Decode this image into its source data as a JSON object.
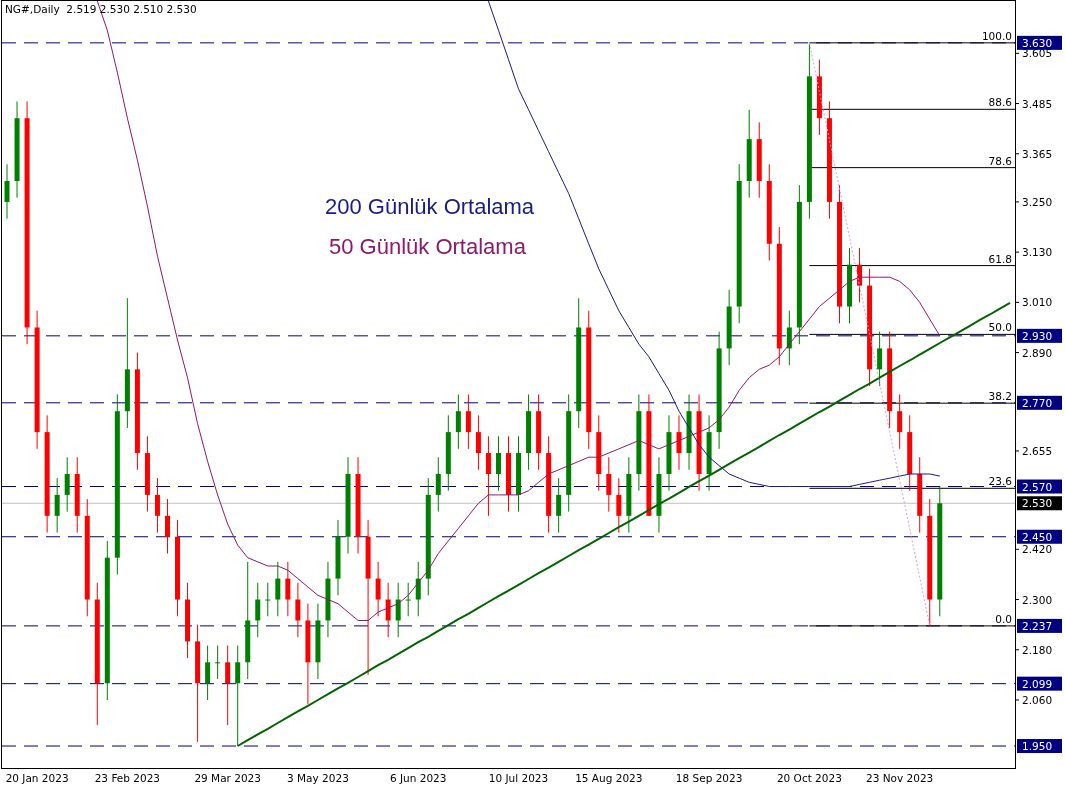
{
  "header": {
    "symbol_info": "NG#,Daily  2.519 2.530 2.510 2.530"
  },
  "chart": {
    "chart_data": {
      "type": "candlestick",
      "categories": [
        null,
        null,
        null,
        "20 Jan 2023",
        null,
        null,
        null,
        null,
        null,
        null,
        null,
        null,
        "23 Feb 2023",
        null,
        null,
        null,
        null,
        null,
        null,
        null,
        null,
        null,
        "29 Mar 2023",
        null,
        null,
        null,
        null,
        null,
        null,
        null,
        null,
        "3 May 2023",
        null,
        null,
        null,
        null,
        null,
        null,
        null,
        null,
        null,
        "6 Jun 2023",
        null,
        null,
        null,
        null,
        null,
        null,
        null,
        null,
        null,
        "10 Jul 2023",
        null,
        null,
        null,
        null,
        null,
        null,
        null,
        null,
        "15 Aug 2023",
        null,
        null,
        null,
        null,
        null,
        null,
        null,
        null,
        null,
        "18 Sep 2023",
        null,
        null,
        null,
        null,
        null,
        null,
        null,
        null,
        null,
        "20 Oct 2023",
        null,
        null,
        null,
        null,
        null,
        null,
        null,
        null,
        "23 Nov 2023",
        null,
        null,
        null,
        null,
        null,
        null,
        null,
        null,
        null,
        null,
        null
      ],
      "ylim": [
        1.8975,
        3.73
      ],
      "yticks": [
        {
          "value": 3.605,
          "label": "3.605"
        },
        {
          "value": 3.485,
          "label": "3.485"
        },
        {
          "value": 3.365,
          "label": "3.365"
        },
        {
          "value": 3.25,
          "label": "3.250"
        },
        {
          "value": 3.13,
          "label": "3.130"
        },
        {
          "value": 3.01,
          "label": "3.010"
        },
        {
          "value": 2.89,
          "label": "2.890"
        },
        {
          "value": 2.655,
          "label": "2.655"
        },
        {
          "value": 2.42,
          "label": "2.420"
        },
        {
          "value": 2.3,
          "label": "2.300"
        },
        {
          "value": 2.18,
          "label": "2.180"
        },
        {
          "value": 2.06,
          "label": "2.060"
        }
      ],
      "ohlc": [
        [
          3.25,
          3.34,
          3.21,
          3.3
        ],
        [
          3.3,
          3.49,
          3.26,
          3.45
        ],
        [
          3.45,
          3.49,
          2.91,
          2.95
        ],
        [
          2.95,
          2.99,
          2.66,
          2.7
        ],
        [
          2.7,
          2.74,
          2.46,
          2.5
        ],
        [
          2.5,
          2.59,
          2.46,
          2.55
        ],
        [
          2.55,
          2.64,
          2.51,
          2.6
        ],
        [
          2.6,
          2.64,
          2.46,
          2.5
        ],
        [
          2.5,
          2.54,
          2.26,
          2.3
        ],
        [
          2.3,
          2.34,
          2.0,
          2.1
        ],
        [
          2.1,
          2.44,
          2.06,
          2.4
        ],
        [
          2.4,
          2.79,
          2.36,
          2.75
        ],
        [
          2.75,
          3.02,
          2.71,
          2.85
        ],
        [
          2.85,
          2.89,
          2.61,
          2.65
        ],
        [
          2.65,
          2.69,
          2.51,
          2.55
        ],
        [
          2.55,
          2.59,
          2.46,
          2.5
        ],
        [
          2.5,
          2.54,
          2.41,
          2.45
        ],
        [
          2.45,
          2.49,
          2.26,
          2.3
        ],
        [
          2.3,
          2.34,
          2.16,
          2.2
        ],
        [
          2.2,
          2.24,
          1.96,
          2.1
        ],
        [
          2.1,
          2.19,
          2.06,
          2.15
        ],
        [
          2.15,
          2.19,
          2.11,
          2.15
        ],
        [
          2.15,
          2.19,
          2.0,
          2.1
        ],
        [
          2.1,
          2.19,
          1.95,
          2.15
        ],
        [
          2.15,
          2.39,
          2.11,
          2.25
        ],
        [
          2.25,
          2.34,
          2.21,
          2.3
        ],
        [
          2.3,
          2.34,
          2.26,
          2.3
        ],
        [
          2.3,
          2.39,
          2.26,
          2.35
        ],
        [
          2.35,
          2.39,
          2.26,
          2.3
        ],
        [
          2.3,
          2.34,
          2.21,
          2.25
        ],
        [
          2.25,
          2.29,
          2.05,
          2.15
        ],
        [
          2.15,
          2.29,
          2.11,
          2.25
        ],
        [
          2.25,
          2.39,
          2.21,
          2.35
        ],
        [
          2.35,
          2.49,
          2.31,
          2.45
        ],
        [
          2.45,
          2.64,
          2.41,
          2.6
        ],
        [
          2.6,
          2.64,
          2.41,
          2.45
        ],
        [
          2.45,
          2.49,
          2.12,
          2.35
        ],
        [
          2.35,
          2.39,
          2.26,
          2.3
        ],
        [
          2.3,
          2.34,
          2.21,
          2.25
        ],
        [
          2.25,
          2.34,
          2.21,
          2.3
        ],
        [
          2.3,
          2.34,
          2.26,
          2.3
        ],
        [
          2.3,
          2.39,
          2.26,
          2.35
        ],
        [
          2.35,
          2.59,
          2.31,
          2.55
        ],
        [
          2.55,
          2.64,
          2.51,
          2.6
        ],
        [
          2.6,
          2.74,
          2.56,
          2.7
        ],
        [
          2.7,
          2.79,
          2.66,
          2.75
        ],
        [
          2.75,
          2.79,
          2.66,
          2.7
        ],
        [
          2.7,
          2.74,
          2.61,
          2.65
        ],
        [
          2.65,
          2.69,
          2.5,
          2.6
        ],
        [
          2.6,
          2.69,
          2.56,
          2.65
        ],
        [
          2.65,
          2.69,
          2.51,
          2.55
        ],
        [
          2.55,
          2.69,
          2.51,
          2.65
        ],
        [
          2.65,
          2.79,
          2.61,
          2.75
        ],
        [
          2.75,
          2.79,
          2.61,
          2.65
        ],
        [
          2.65,
          2.69,
          2.46,
          2.5
        ],
        [
          2.5,
          2.59,
          2.46,
          2.55
        ],
        [
          2.55,
          2.79,
          2.51,
          2.75
        ],
        [
          2.75,
          3.02,
          2.71,
          2.95
        ],
        [
          2.95,
          2.99,
          2.66,
          2.7
        ],
        [
          2.7,
          2.74,
          2.56,
          2.6
        ],
        [
          2.6,
          2.64,
          2.51,
          2.55
        ],
        [
          2.55,
          2.59,
          2.46,
          2.5
        ],
        [
          2.5,
          2.64,
          2.46,
          2.6
        ],
        [
          2.6,
          2.79,
          2.56,
          2.75
        ],
        [
          2.75,
          2.79,
          2.5,
          2.5
        ],
        [
          2.5,
          2.64,
          2.46,
          2.6
        ],
        [
          2.6,
          2.74,
          2.56,
          2.7
        ],
        [
          2.7,
          2.74,
          2.61,
          2.65
        ],
        [
          2.65,
          2.79,
          2.61,
          2.75
        ],
        [
          2.75,
          2.79,
          2.56,
          2.6
        ],
        [
          2.6,
          2.74,
          2.56,
          2.7
        ],
        [
          2.7,
          2.94,
          2.66,
          2.9
        ],
        [
          2.9,
          3.04,
          2.86,
          3.0
        ],
        [
          3.0,
          3.34,
          2.96,
          3.3
        ],
        [
          3.3,
          3.47,
          3.26,
          3.4
        ],
        [
          3.4,
          3.44,
          3.26,
          3.3
        ],
        [
          3.3,
          3.34,
          3.11,
          3.15
        ],
        [
          3.15,
          3.19,
          2.86,
          2.9
        ],
        [
          2.9,
          2.99,
          2.86,
          2.95
        ],
        [
          2.95,
          3.29,
          2.91,
          3.25
        ],
        [
          3.25,
          3.63,
          3.21,
          3.55
        ],
        [
          3.55,
          3.59,
          3.41,
          3.45
        ],
        [
          3.45,
          3.49,
          3.21,
          3.25
        ],
        [
          3.25,
          3.29,
          2.96,
          3.0
        ],
        [
          3.0,
          3.14,
          2.96,
          3.1
        ],
        [
          3.1,
          3.14,
          3.01,
          3.05
        ],
        [
          3.05,
          3.09,
          2.81,
          2.85
        ],
        [
          2.85,
          2.94,
          2.81,
          2.9
        ],
        [
          2.9,
          2.94,
          2.71,
          2.75
        ],
        [
          2.75,
          2.79,
          2.66,
          2.7
        ],
        [
          2.7,
          2.74,
          2.56,
          2.6
        ],
        [
          2.6,
          2.64,
          2.46,
          2.5
        ],
        [
          2.5,
          2.54,
          2.237,
          2.3
        ],
        [
          2.3,
          2.57,
          2.26,
          2.53
        ],
        null,
        null,
        null,
        null,
        null,
        null,
        null
      ],
      "series": [
        {
          "name": "200 Günlük Ortalama",
          "type": "line",
          "color": "#1a1a8c",
          "values": [
            null,
            null,
            null,
            null,
            null,
            null,
            null,
            null,
            null,
            null,
            null,
            null,
            null,
            null,
            null,
            null,
            null,
            null,
            null,
            null,
            null,
            null,
            null,
            null,
            null,
            null,
            null,
            null,
            null,
            null,
            null,
            null,
            null,
            null,
            null,
            null,
            null,
            null,
            null,
            null,
            null,
            null,
            null,
            null,
            null,
            null,
            null,
            null,
            3.73,
            3.66,
            3.59,
            3.52,
            3.47,
            3.42,
            3.37,
            3.32,
            3.27,
            3.21,
            3.15,
            3.09,
            3.04,
            2.99,
            2.95,
            2.91,
            2.88,
            2.84,
            2.8,
            2.75,
            2.71,
            2.67,
            2.64,
            2.62,
            2.6,
            2.59,
            2.58,
            2.575,
            2.57,
            2.57,
            2.57,
            2.57,
            2.57,
            2.57,
            2.57,
            2.57,
            2.57,
            2.575,
            2.58,
            2.585,
            2.59,
            2.595,
            2.6,
            2.6,
            2.6,
            2.595,
            null,
            null,
            null,
            null,
            null,
            null,
            null
          ]
        },
        {
          "name": "50 Günlük Ortalama",
          "type": "line",
          "color": "#8b1a6a",
          "values": [
            null,
            null,
            null,
            null,
            null,
            null,
            null,
            null,
            null,
            3.73,
            3.66,
            3.56,
            3.45,
            3.35,
            3.24,
            3.12,
            3.02,
            2.92,
            2.83,
            2.72,
            2.63,
            2.55,
            2.48,
            2.43,
            2.4,
            2.39,
            2.38,
            2.38,
            2.37,
            2.35,
            2.33,
            2.31,
            2.3,
            2.29,
            2.27,
            2.25,
            2.25,
            2.27,
            2.28,
            2.29,
            2.31,
            2.34,
            2.37,
            2.41,
            2.44,
            2.47,
            2.5,
            2.53,
            2.55,
            2.55,
            2.55,
            2.55,
            2.56,
            2.58,
            2.6,
            2.61,
            2.62,
            2.63,
            2.64,
            2.64,
            2.65,
            2.66,
            2.67,
            2.68,
            2.67,
            2.66,
            2.67,
            2.68,
            2.69,
            2.7,
            2.71,
            2.73,
            2.76,
            2.8,
            2.83,
            2.85,
            2.86,
            2.88,
            2.91,
            2.94,
            2.97,
            3.0,
            3.02,
            3.04,
            3.06,
            3.07,
            3.07,
            3.07,
            3.07,
            3.06,
            3.04,
            3.01,
            2.97,
            2.93,
            null,
            null,
            null,
            null,
            null,
            null,
            null
          ]
        },
        {
          "type": "line",
          "color": "#006400",
          "values": [
            null,
            null,
            null,
            null,
            null,
            null,
            null,
            null,
            null,
            null,
            null,
            null,
            null,
            null,
            null,
            null,
            null,
            null,
            null,
            null,
            null,
            null,
            null,
            1.95,
            1.964,
            1.978,
            1.991,
            2.005,
            2.019,
            2.033,
            2.046,
            2.06,
            2.074,
            2.088,
            2.101,
            2.115,
            2.129,
            2.143,
            2.156,
            2.17,
            2.184,
            2.198,
            2.211,
            2.225,
            2.239,
            2.253,
            2.266,
            2.28,
            2.294,
            2.308,
            2.321,
            2.335,
            2.349,
            2.363,
            2.376,
            2.39,
            2.404,
            2.418,
            2.431,
            2.445,
            2.459,
            2.473,
            2.486,
            2.5,
            2.514,
            2.528,
            2.541,
            2.555,
            2.569,
            2.583,
            2.596,
            2.61,
            2.624,
            2.638,
            2.651,
            2.665,
            2.679,
            2.693,
            2.706,
            2.72,
            2.734,
            2.748,
            2.761,
            2.775,
            2.789,
            2.803,
            2.816,
            2.83,
            2.844,
            2.858,
            2.871,
            2.885,
            2.899,
            2.913,
            2.926,
            2.94,
            2.954,
            2.968,
            2.981,
            2.995,
            3.009
          ]
        },
        {
          "type": "line",
          "line_style": "dotted",
          "color": "#d8a0d8",
          "values": [
            null,
            null,
            null,
            null,
            null,
            null,
            null,
            null,
            null,
            null,
            null,
            null,
            null,
            null,
            null,
            null,
            null,
            null,
            null,
            null,
            null,
            null,
            null,
            null,
            null,
            null,
            null,
            null,
            null,
            null,
            null,
            null,
            null,
            null,
            null,
            null,
            null,
            null,
            null,
            null,
            null,
            null,
            null,
            null,
            null,
            null,
            null,
            null,
            null,
            null,
            null,
            null,
            null,
            null,
            null,
            null,
            null,
            null,
            null,
            null,
            null,
            null,
            null,
            null,
            null,
            null,
            null,
            null,
            null,
            null,
            null,
            null,
            null,
            null,
            null,
            null,
            null,
            null,
            null,
            null,
            3.63,
            3.514,
            3.398,
            3.282,
            3.166,
            3.05,
            2.934,
            2.817,
            2.701,
            2.585,
            2.469,
            2.353,
            2.237,
            null,
            null,
            null,
            null,
            null,
            null,
            null,
            null
          ]
        }
      ],
      "ref_lines": [
        {
          "axis": "y",
          "value": 3.63,
          "label": "3.630",
          "color": "#000080"
        },
        {
          "axis": "y",
          "value": 2.93,
          "label": "2.930",
          "color": "#000080"
        },
        {
          "axis": "y",
          "value": 2.77,
          "label": "2.770",
          "color": "#000080"
        },
        {
          "axis": "y",
          "value": 2.57,
          "label": "2.570",
          "color": "#000080"
        },
        {
          "axis": "y",
          "value": 2.53,
          "color": "#c0c0c0"
        },
        {
          "axis": "y",
          "value": 2.45,
          "label": "2.450",
          "color": "#000080"
        },
        {
          "axis": "y",
          "value": 2.237,
          "label": "2.237",
          "color": "#000080"
        },
        {
          "axis": "y",
          "value": 2.099,
          "label": "2.099",
          "color": "#000080"
        },
        {
          "axis": "y",
          "value": 1.95,
          "label": "1.950",
          "color": "#000080"
        }
      ]
    },
    "last_price": {
      "label": "2.530"
    },
    "fibonacci_levels": [
      {
        "label": "100.0"
      },
      {
        "label": "88.6"
      },
      {
        "label": "78.6"
      },
      {
        "label": "61.8"
      },
      {
        "label": "50.0"
      },
      {
        "label": "38.2"
      },
      {
        "label": "23.6"
      },
      {
        "label": "0.0"
      }
    ]
  }
}
